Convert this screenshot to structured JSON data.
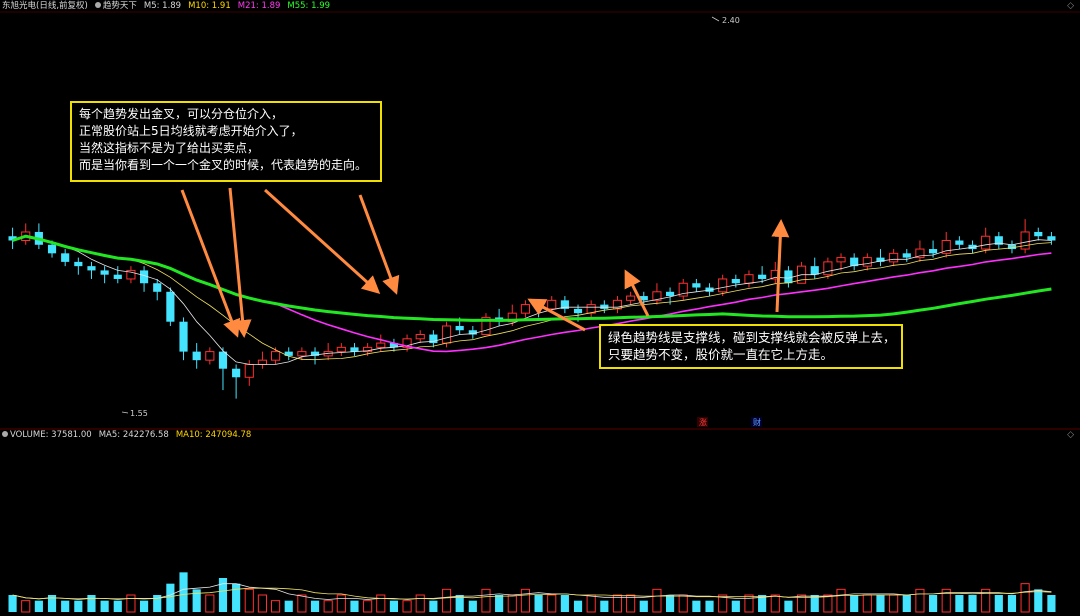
{
  "header": {
    "stock_name": "东旭光电(日线,前复权)",
    "indicator_name": "趋势天下",
    "ma5": "M5: 1.89",
    "ma10": "M10: 1.91",
    "ma21": "M21: 1.89",
    "ma55": "M55: 1.99"
  },
  "volume_header": {
    "label": "VOLUME: 37581.00",
    "ma5": "MA5: 242276.58",
    "ma10": "MA10: 247094.78"
  },
  "annotations": {
    "box1_lines": [
      "每个趋势发出金叉，可以分仓位介入，",
      "正常股价站上5日均线就考虑开始介入了，",
      "当然这指标不是为了给出买卖点，",
      "而是当你看到一个一个金叉的时候，代表趋势的走向。"
    ],
    "box2_lines": [
      "绿色趋势线是支撑线，碰到支撑线就会被反弹上去，",
      "只要趋势不变，股价就一直在它上方走。"
    ]
  },
  "markers": {
    "zhang": "涨",
    "cai": "财"
  },
  "colors": {
    "up": "#ff3030",
    "down": "#44e4ff",
    "ma_yellow": "#f0e060",
    "ma_white": "#e8e8e8",
    "ma21": "#ff30ff",
    "ma55": "#22e622",
    "arrow": "#ff8a40",
    "box_border": "#f0e000"
  },
  "chart_data": {
    "type": "candlestick",
    "price_high_label": "2.40",
    "price_low_label": "1.55",
    "price_range": [
      1.5,
      2.45
    ],
    "candles": [
      [
        1.93,
        1.92,
        1.95,
        1.9
      ],
      [
        1.92,
        1.94,
        1.96,
        1.91
      ],
      [
        1.94,
        1.91,
        1.96,
        1.9
      ],
      [
        1.91,
        1.89,
        1.92,
        1.88
      ],
      [
        1.89,
        1.87,
        1.9,
        1.86
      ],
      [
        1.87,
        1.86,
        1.88,
        1.84
      ],
      [
        1.86,
        1.85,
        1.87,
        1.83
      ],
      [
        1.85,
        1.84,
        1.86,
        1.82
      ],
      [
        1.84,
        1.83,
        1.86,
        1.82
      ],
      [
        1.83,
        1.85,
        1.86,
        1.82
      ],
      [
        1.85,
        1.82,
        1.86,
        1.8
      ],
      [
        1.82,
        1.8,
        1.83,
        1.78
      ],
      [
        1.8,
        1.73,
        1.81,
        1.72
      ],
      [
        1.73,
        1.66,
        1.74,
        1.64
      ],
      [
        1.66,
        1.64,
        1.68,
        1.62
      ],
      [
        1.64,
        1.66,
        1.67,
        1.63
      ],
      [
        1.66,
        1.62,
        1.67,
        1.57
      ],
      [
        1.62,
        1.6,
        1.63,
        1.55
      ],
      [
        1.6,
        1.63,
        1.64,
        1.58
      ],
      [
        1.63,
        1.64,
        1.66,
        1.62
      ],
      [
        1.64,
        1.66,
        1.67,
        1.63
      ],
      [
        1.66,
        1.65,
        1.67,
        1.64
      ],
      [
        1.65,
        1.66,
        1.67,
        1.64
      ],
      [
        1.66,
        1.65,
        1.67,
        1.63
      ],
      [
        1.65,
        1.66,
        1.68,
        1.64
      ],
      [
        1.66,
        1.67,
        1.68,
        1.65
      ],
      [
        1.67,
        1.66,
        1.68,
        1.65
      ],
      [
        1.66,
        1.67,
        1.68,
        1.65
      ],
      [
        1.67,
        1.68,
        1.7,
        1.66
      ],
      [
        1.68,
        1.67,
        1.69,
        1.66
      ],
      [
        1.67,
        1.69,
        1.7,
        1.66
      ],
      [
        1.69,
        1.7,
        1.71,
        1.68
      ],
      [
        1.7,
        1.68,
        1.71,
        1.67
      ],
      [
        1.68,
        1.72,
        1.73,
        1.67
      ],
      [
        1.72,
        1.71,
        1.74,
        1.7
      ],
      [
        1.71,
        1.7,
        1.72,
        1.69
      ],
      [
        1.7,
        1.74,
        1.75,
        1.7
      ],
      [
        1.74,
        1.73,
        1.76,
        1.72
      ],
      [
        1.73,
        1.75,
        1.77,
        1.72
      ],
      [
        1.75,
        1.77,
        1.78,
        1.74
      ],
      [
        1.77,
        1.76,
        1.78,
        1.74
      ],
      [
        1.76,
        1.78,
        1.79,
        1.75
      ],
      [
        1.78,
        1.76,
        1.79,
        1.75
      ],
      [
        1.76,
        1.75,
        1.77,
        1.73
      ],
      [
        1.75,
        1.77,
        1.78,
        1.74
      ],
      [
        1.77,
        1.76,
        1.78,
        1.75
      ],
      [
        1.76,
        1.78,
        1.79,
        1.75
      ],
      [
        1.78,
        1.79,
        1.8,
        1.77
      ],
      [
        1.79,
        1.78,
        1.8,
        1.77
      ],
      [
        1.78,
        1.8,
        1.82,
        1.77
      ],
      [
        1.8,
        1.79,
        1.81,
        1.77
      ],
      [
        1.79,
        1.82,
        1.83,
        1.78
      ],
      [
        1.82,
        1.81,
        1.83,
        1.8
      ],
      [
        1.81,
        1.8,
        1.82,
        1.79
      ],
      [
        1.8,
        1.83,
        1.84,
        1.79
      ],
      [
        1.83,
        1.82,
        1.84,
        1.81
      ],
      [
        1.82,
        1.84,
        1.85,
        1.81
      ],
      [
        1.84,
        1.83,
        1.86,
        1.82
      ],
      [
        1.83,
        1.85,
        1.87,
        1.82
      ],
      [
        1.85,
        1.82,
        1.86,
        1.81
      ],
      [
        1.82,
        1.86,
        1.87,
        1.82
      ],
      [
        1.86,
        1.84,
        1.88,
        1.83
      ],
      [
        1.84,
        1.87,
        1.88,
        1.83
      ],
      [
        1.87,
        1.88,
        1.89,
        1.85
      ],
      [
        1.88,
        1.86,
        1.89,
        1.85
      ],
      [
        1.86,
        1.88,
        1.89,
        1.85
      ],
      [
        1.88,
        1.87,
        1.9,
        1.86
      ],
      [
        1.87,
        1.89,
        1.9,
        1.86
      ],
      [
        1.89,
        1.88,
        1.9,
        1.87
      ],
      [
        1.88,
        1.9,
        1.92,
        1.87
      ],
      [
        1.9,
        1.89,
        1.92,
        1.88
      ],
      [
        1.89,
        1.92,
        1.94,
        1.88
      ],
      [
        1.92,
        1.91,
        1.93,
        1.9
      ],
      [
        1.91,
        1.9,
        1.92,
        1.89
      ],
      [
        1.9,
        1.93,
        1.95,
        1.89
      ],
      [
        1.93,
        1.91,
        1.94,
        1.9
      ],
      [
        1.91,
        1.9,
        1.92,
        1.89
      ],
      [
        1.9,
        1.94,
        1.97,
        1.89
      ],
      [
        1.94,
        1.93,
        1.95,
        1.92
      ],
      [
        1.93,
        1.92,
        1.94,
        1.91
      ]
    ],
    "volume": [
      3,
      2,
      2,
      3,
      2,
      2,
      3,
      2,
      2,
      3,
      2,
      3,
      5,
      7,
      4,
      3,
      6,
      5,
      4,
      3,
      2,
      2,
      3,
      2,
      2,
      3,
      2,
      2,
      3,
      2,
      2,
      3,
      2,
      4,
      3,
      2,
      4,
      3,
      3,
      4,
      3,
      3,
      3,
      2,
      3,
      2,
      3,
      3,
      2,
      4,
      3,
      3,
      2,
      2,
      3,
      2,
      3,
      3,
      3,
      2,
      3,
      3,
      3,
      4,
      3,
      3,
      3,
      3,
      3,
      4,
      3,
      4,
      3,
      3,
      4,
      3,
      3,
      5,
      4,
      3
    ],
    "volume_ylim": [
      0,
      30
    ]
  }
}
